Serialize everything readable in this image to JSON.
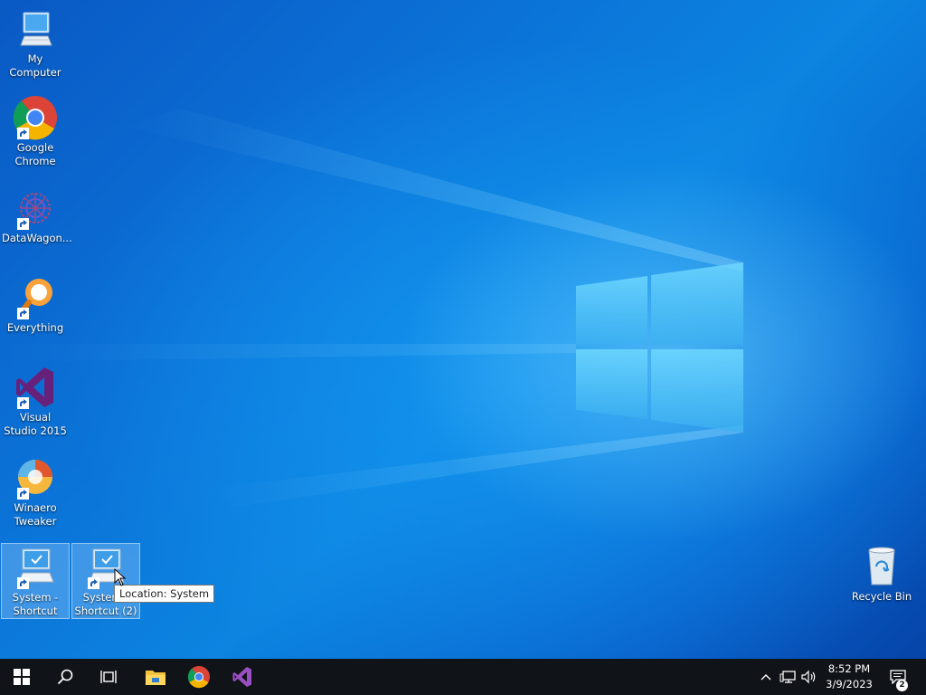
{
  "desktop": {
    "icons": [
      {
        "label": "My Computer",
        "icon": "monitor-icon",
        "shortcut": false
      },
      {
        "label": "Google Chrome",
        "icon": "chrome-icon",
        "shortcut": true
      },
      {
        "label": "DataWagon...",
        "icon": "datawagon-icon",
        "shortcut": true
      },
      {
        "label": "Everything",
        "icon": "everything-search-icon",
        "shortcut": true
      },
      {
        "label": "Visual Studio 2015",
        "icon": "visual-studio-icon",
        "shortcut": true
      },
      {
        "label": "Winaero Tweaker",
        "icon": "winaero-tweaker-icon",
        "shortcut": true
      },
      {
        "label": "System - Shortcut",
        "icon": "system-monitor-icon",
        "shortcut": true,
        "selected": true
      },
      {
        "label": "System - Shortcut (2)",
        "icon": "system-monitor-icon",
        "shortcut": true,
        "selected": true
      },
      {
        "label": "Recycle Bin",
        "icon": "recycle-bin-icon",
        "shortcut": false
      }
    ],
    "tooltip": "Location: System"
  },
  "taskbar": {
    "pinned": [
      "start-icon",
      "search-icon",
      "task-view-icon",
      "file-explorer-icon",
      "chrome-icon",
      "visual-studio-icon"
    ],
    "clock": {
      "time": "8:52 PM",
      "date": "3/9/2023"
    },
    "notification_count": "2",
    "tray": [
      "chevron-up-icon",
      "network-icon",
      "volume-icon"
    ]
  },
  "colors": {
    "taskbar": "#101418",
    "desktop_accent": "#0b74d8"
  }
}
